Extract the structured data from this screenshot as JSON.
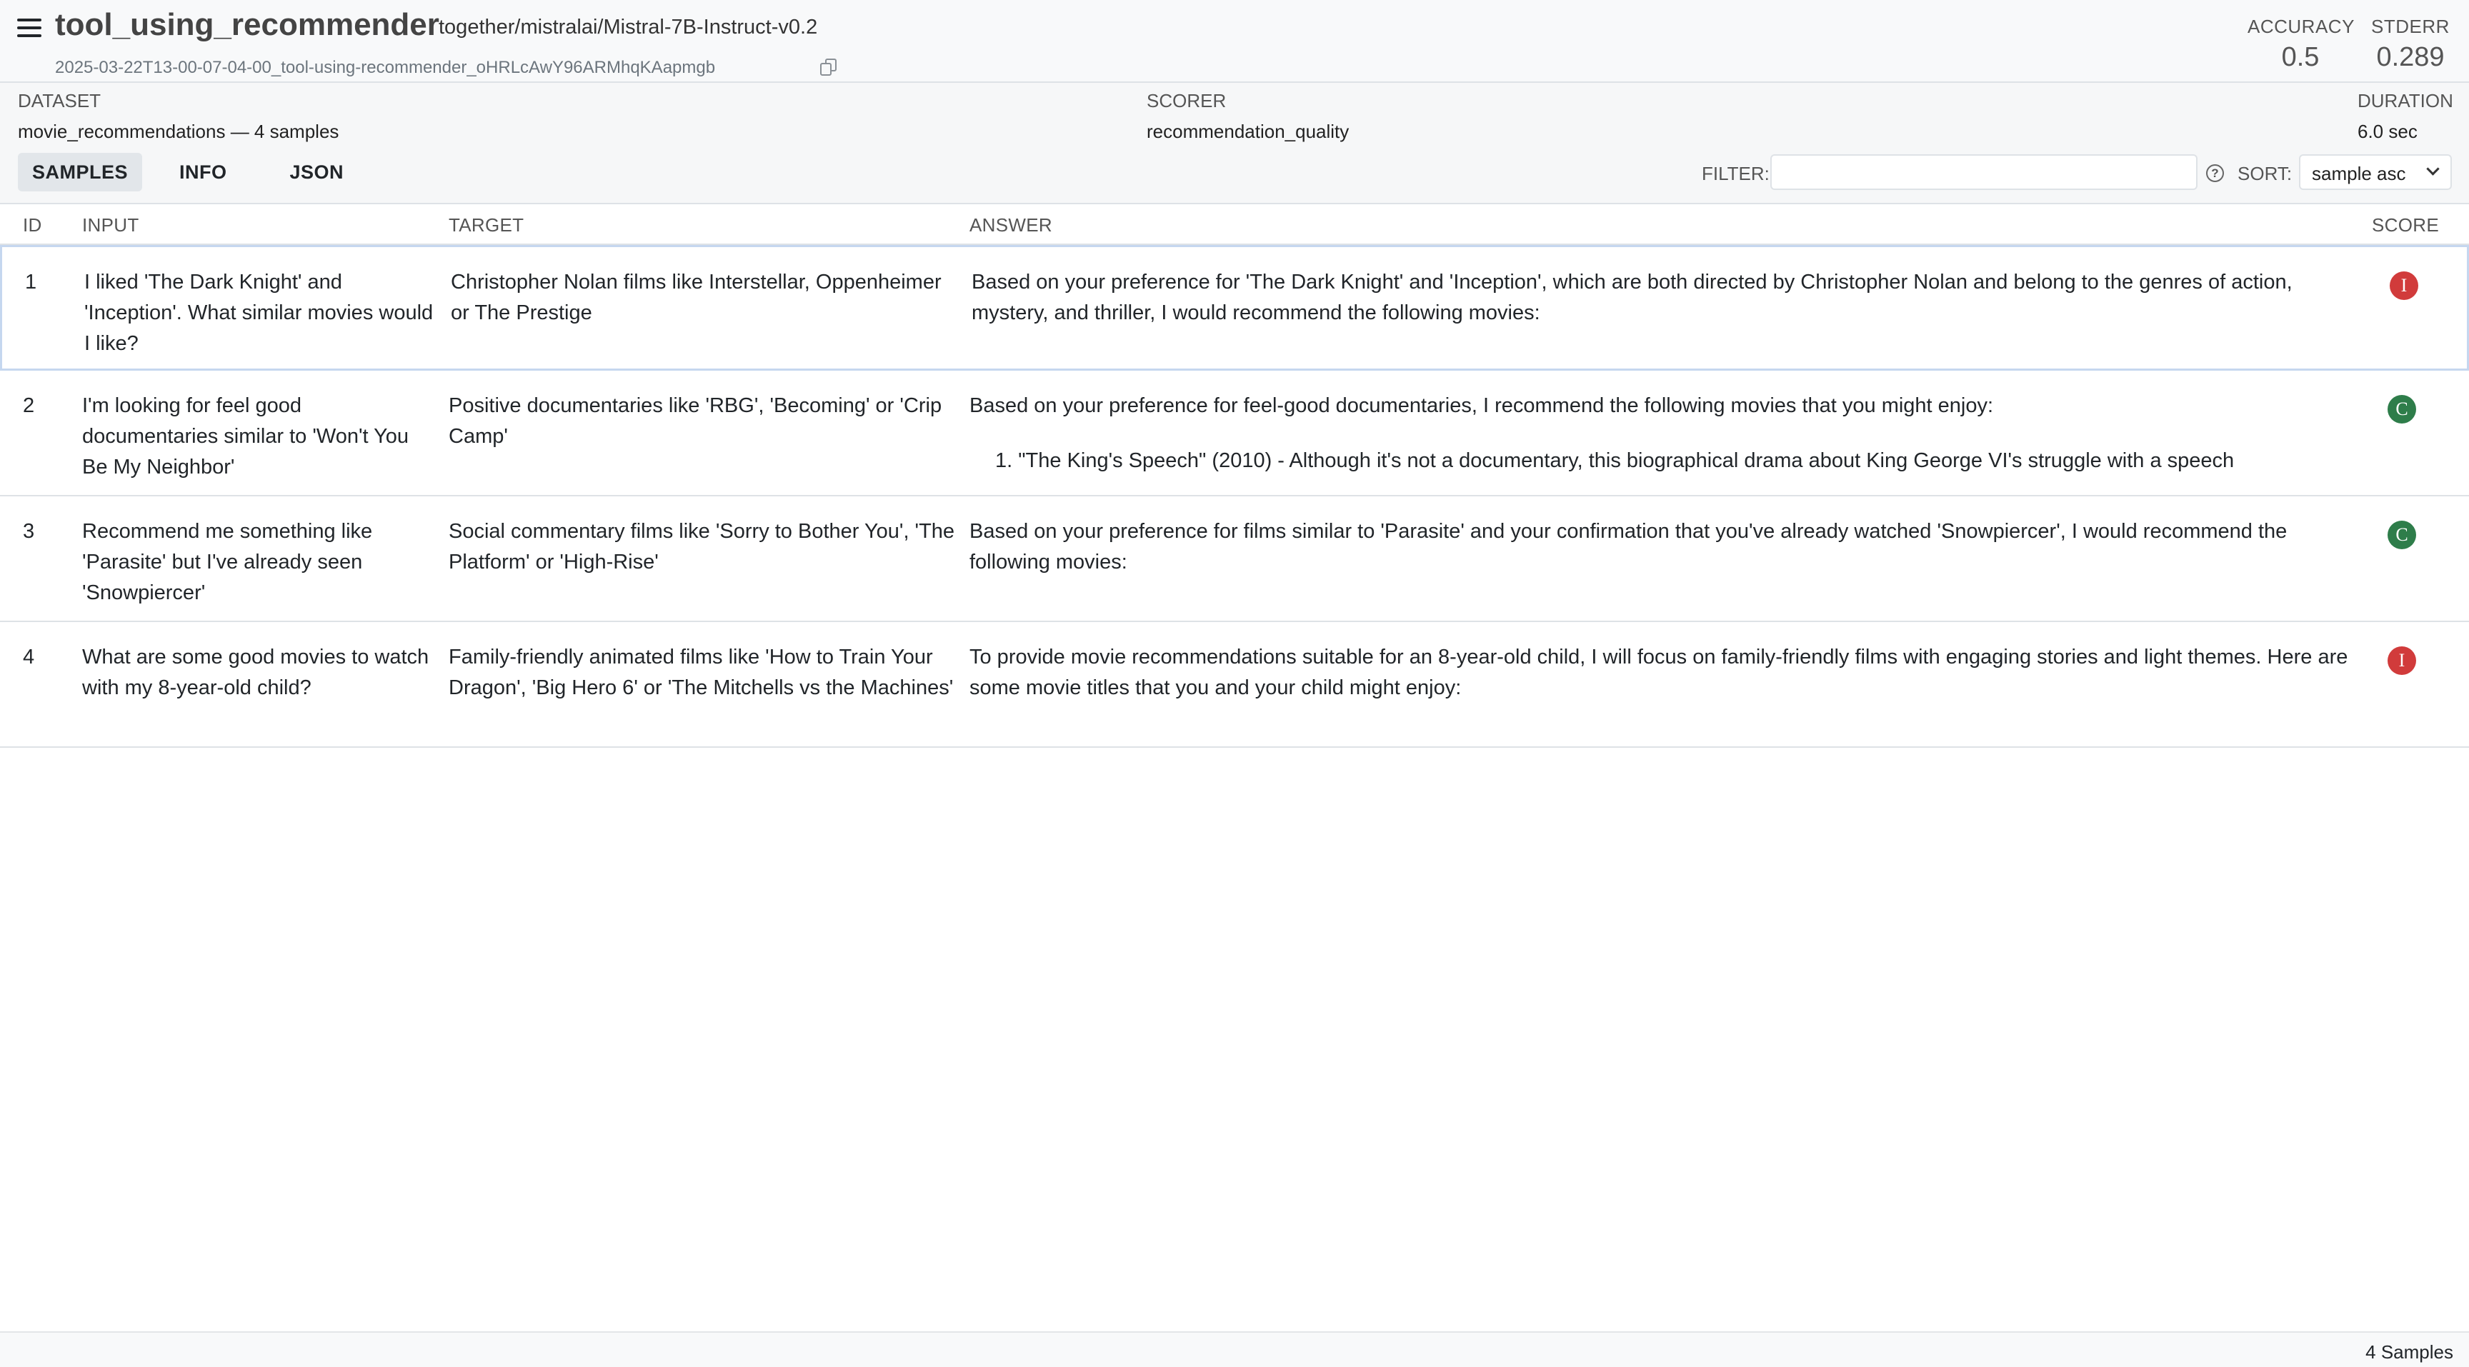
{
  "header": {
    "task_name": "tool_using_recommender",
    "model": "together/mistralai/Mistral-7B-Instruct-v0.2",
    "log_file": "2025-03-22T13-00-07-04-00_tool-using-recommender_oHRLcAwY96ARMhqKAapmgb",
    "metrics": {
      "accuracy_label": "ACCURACY",
      "accuracy_value": "0.5",
      "stderr_label": "STDERR",
      "stderr_value": "0.289"
    }
  },
  "info": {
    "dataset_label": "DATASET",
    "dataset_value": "movie_recommendations — 4 samples",
    "scorer_label": "SCORER",
    "scorer_value": "recommendation_quality",
    "duration_label": "DURATION",
    "duration_value": "6.0 sec"
  },
  "tabs": [
    {
      "label": "SAMPLES",
      "active": true
    },
    {
      "label": "INFO",
      "active": false
    },
    {
      "label": "JSON",
      "active": false
    }
  ],
  "filter": {
    "label": "FILTER:",
    "value": "",
    "placeholder": ""
  },
  "sort": {
    "label": "SORT:",
    "value": "sample asc"
  },
  "table": {
    "columns": {
      "id": "ID",
      "input": "INPUT",
      "target": "TARGET",
      "answer": "ANSWER",
      "score": "SCORE"
    },
    "rows": [
      {
        "id": "1",
        "input": "I liked 'The Dark Knight' and 'Inception'. What similar movies would I like?",
        "target": "Christopher Nolan films like Interstellar, Oppenheimer or The Prestige",
        "answer": "Based on your preference for 'The Dark Knight' and 'Inception', which are both directed by Christopher Nolan and belong to the genres of action, mystery, and thriller, I would recommend the following movies:",
        "answer_item": "",
        "score": "I"
      },
      {
        "id": "2",
        "input": "I'm looking for feel good documentaries similar to 'Won't You Be My Neighbor'",
        "target": "Positive documentaries like 'RBG', 'Becoming' or 'Crip Camp'",
        "answer": "Based on your preference for feel-good documentaries, I recommend the following movies that you might enjoy:",
        "answer_item": "1. \"The King's Speech\" (2010) - Although it's not a documentary, this biographical drama about King George VI's struggle with a speech",
        "score": "C"
      },
      {
        "id": "3",
        "input": "Recommend me something like 'Parasite' but I've already seen 'Snowpiercer'",
        "target": "Social commentary films like 'Sorry to Bother You', 'The Platform' or 'High-Rise'",
        "answer": "Based on your preference for films similar to 'Parasite' and your confirmation that you've already watched 'Snowpiercer', I would recommend the following movies:",
        "answer_item": "",
        "score": "C"
      },
      {
        "id": "4",
        "input": "What are some good movies to watch with my 8-year-old child?",
        "target": "Family-friendly animated films like 'How to Train Your Dragon', 'Big Hero 6' or 'The Mitchells vs the Machines'",
        "answer": "To provide movie recommendations suitable for an 8-year-old child, I will focus on family-friendly films with engaging stories and light themes. Here are some movie titles that you and your child might enjoy:",
        "answer_item": "",
        "score": "I"
      }
    ]
  },
  "footer": {
    "count": "4 Samples"
  },
  "colors": {
    "incorrect": "#d13b3b",
    "correct": "#2e7d4a",
    "selected_border": "#c5d7ef"
  }
}
